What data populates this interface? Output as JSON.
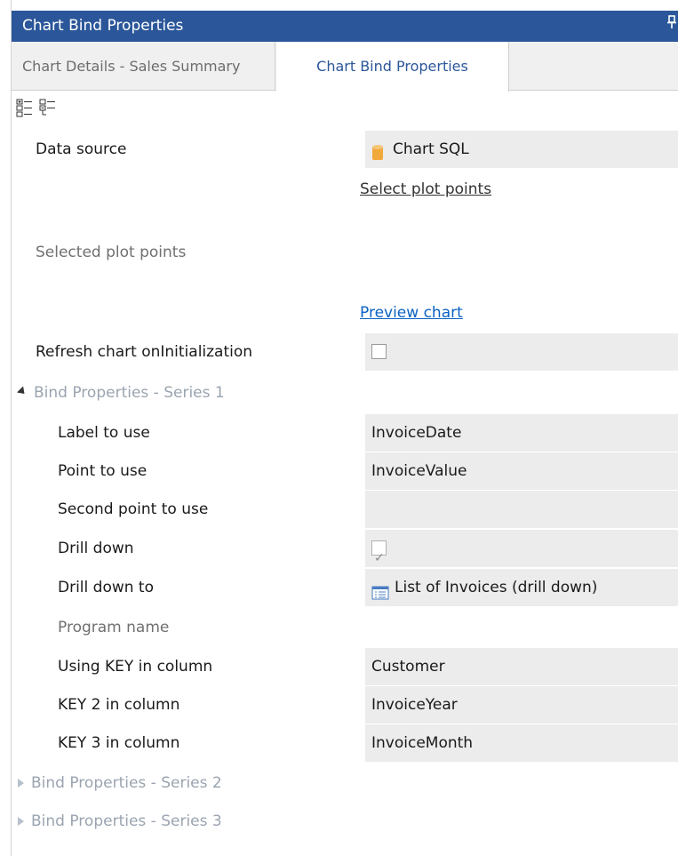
{
  "window": {
    "title": "Chart Bind Properties",
    "pin_glyph": "📌"
  },
  "tabs": [
    {
      "label": "Chart Details - Sales Summary"
    },
    {
      "label": "Chart Bind Properties"
    }
  ],
  "toolbar": {
    "icons": [
      "categorized-view-icon",
      "alphabetical-view-icon"
    ]
  },
  "properties": {
    "data_source": {
      "label": "Data source",
      "value": "Chart SQL",
      "icon": "database-icon"
    },
    "select_plot_points": {
      "link": "Select plot points"
    },
    "selected_plot_points": {
      "label": "Selected plot points"
    },
    "preview_chart": {
      "link": "Preview chart"
    },
    "refresh_on_init": {
      "label": "Refresh chart onInitialization",
      "checked": false
    }
  },
  "series1": {
    "header": "Bind Properties - Series 1",
    "rows": {
      "label_to_use": {
        "label": "Label to use",
        "value": "InvoiceDate"
      },
      "point_to_use": {
        "label": "Point to use",
        "value": "InvoiceValue"
      },
      "second_point": {
        "label": "Second point to use",
        "value": ""
      },
      "drill_down": {
        "label": "Drill down",
        "checked": true
      },
      "drill_down_to": {
        "label": "Drill down to",
        "value": "List of Invoices (drill down)",
        "icon": "list-form-icon"
      },
      "program_name": {
        "label": "Program name"
      },
      "key1": {
        "label": "Using KEY in column",
        "value": "Customer"
      },
      "key2": {
        "label": "KEY 2 in column",
        "value": "InvoiceYear"
      },
      "key3": {
        "label": "KEY 3 in column",
        "value": "InvoiceMonth"
      }
    }
  },
  "series2": {
    "header": "Bind Properties - Series 2"
  },
  "series3": {
    "header": "Bind Properties - Series 3"
  },
  "colors": {
    "titlebar": "#2b579a",
    "active_tab_text": "#2b579a",
    "link_blue": "#0b62c3",
    "value_bg": "#ececec"
  }
}
